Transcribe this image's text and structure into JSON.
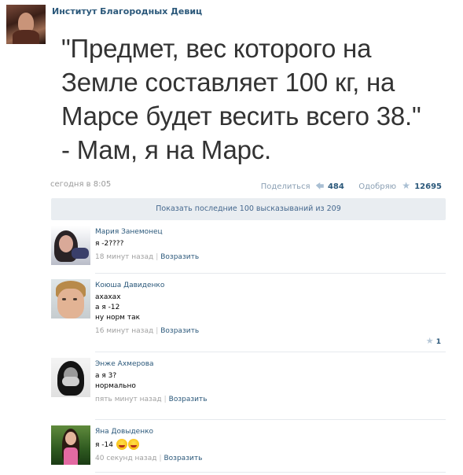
{
  "post": {
    "community_name": "Институт Благородных Девиц",
    "text_lines": [
      "\"Предмет, вес которого на",
      "Земле составляет 100 кг, на",
      "Марсе будет весить всего 38.\"",
      "- Мам, я на Марс."
    ],
    "date": "сегодня в 8:05",
    "share_label": "Поделиться",
    "share_count": "484",
    "like_label": "Одобряю",
    "like_count": "12695"
  },
  "show_more_label": "Показать последние 100 высказываний из 209",
  "comments": [
    {
      "author": "Мария Занемонец",
      "lines": [
        "я -2????"
      ],
      "time": "18 минут назад",
      "reply_label": "Возразить"
    },
    {
      "author": "Коюша Давиденко",
      "lines": [
        "ахахах",
        "а я -12",
        "ну норм так"
      ],
      "time": "16 минут назад",
      "reply_label": "Возразить",
      "likes": "1"
    },
    {
      "author": "Энже Ахмерова",
      "lines": [
        "а я 3?",
        "нормально"
      ],
      "time": "пять минут назад",
      "reply_label": "Возразить"
    },
    {
      "author": "Яна Довыденко",
      "lines": [
        "я -14"
      ],
      "time": "40 секунд назад",
      "reply_label": "Возразить",
      "emoji": "laughing-face-icon"
    }
  ],
  "icons": {
    "share": "share-arrow-icon",
    "like": "star-icon"
  },
  "colors": {
    "link": "#2b587a",
    "show_more_bg": "#e9edf1",
    "post_text": "#333333"
  }
}
